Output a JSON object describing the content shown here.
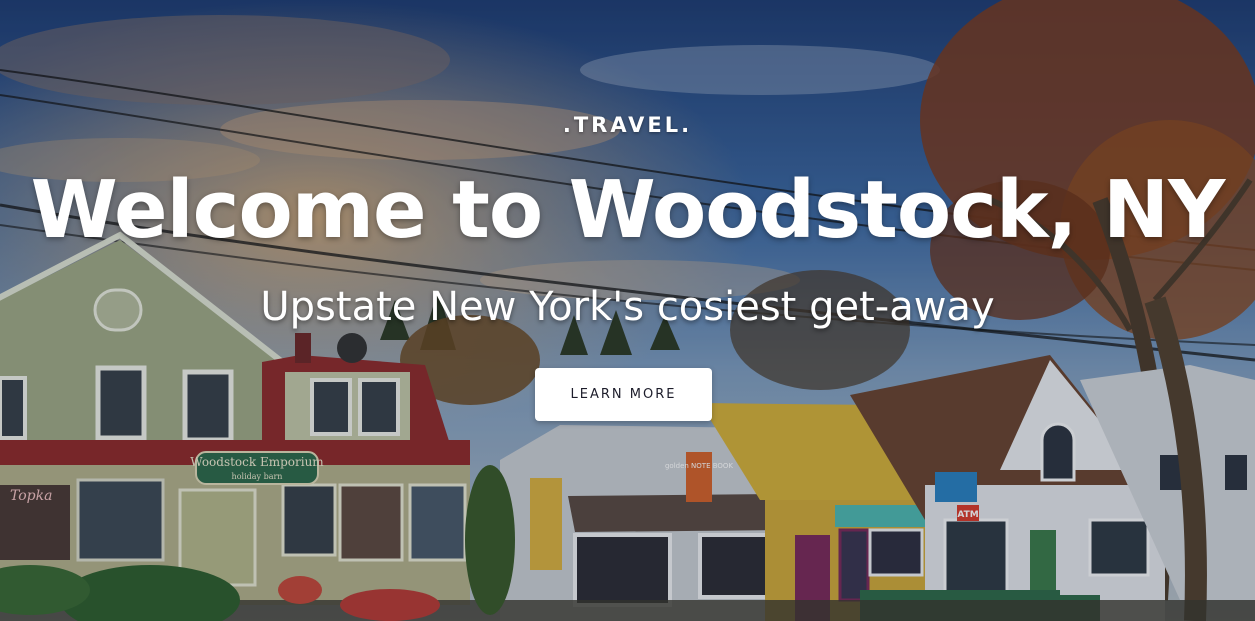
{
  "hero": {
    "eyebrow": ".TRAVEL.",
    "title": "Welcome to Woodstock, NY",
    "subtitle": "Upstate New York's cosiest get-away",
    "cta_label": "LEARN MORE"
  },
  "signs": {
    "emporium": "Woodstock Emporium",
    "emporium_sub": "holiday barn",
    "topka": "Topka",
    "golden_notebook": "golden NOTE BOOK",
    "atm": "ATM"
  }
}
